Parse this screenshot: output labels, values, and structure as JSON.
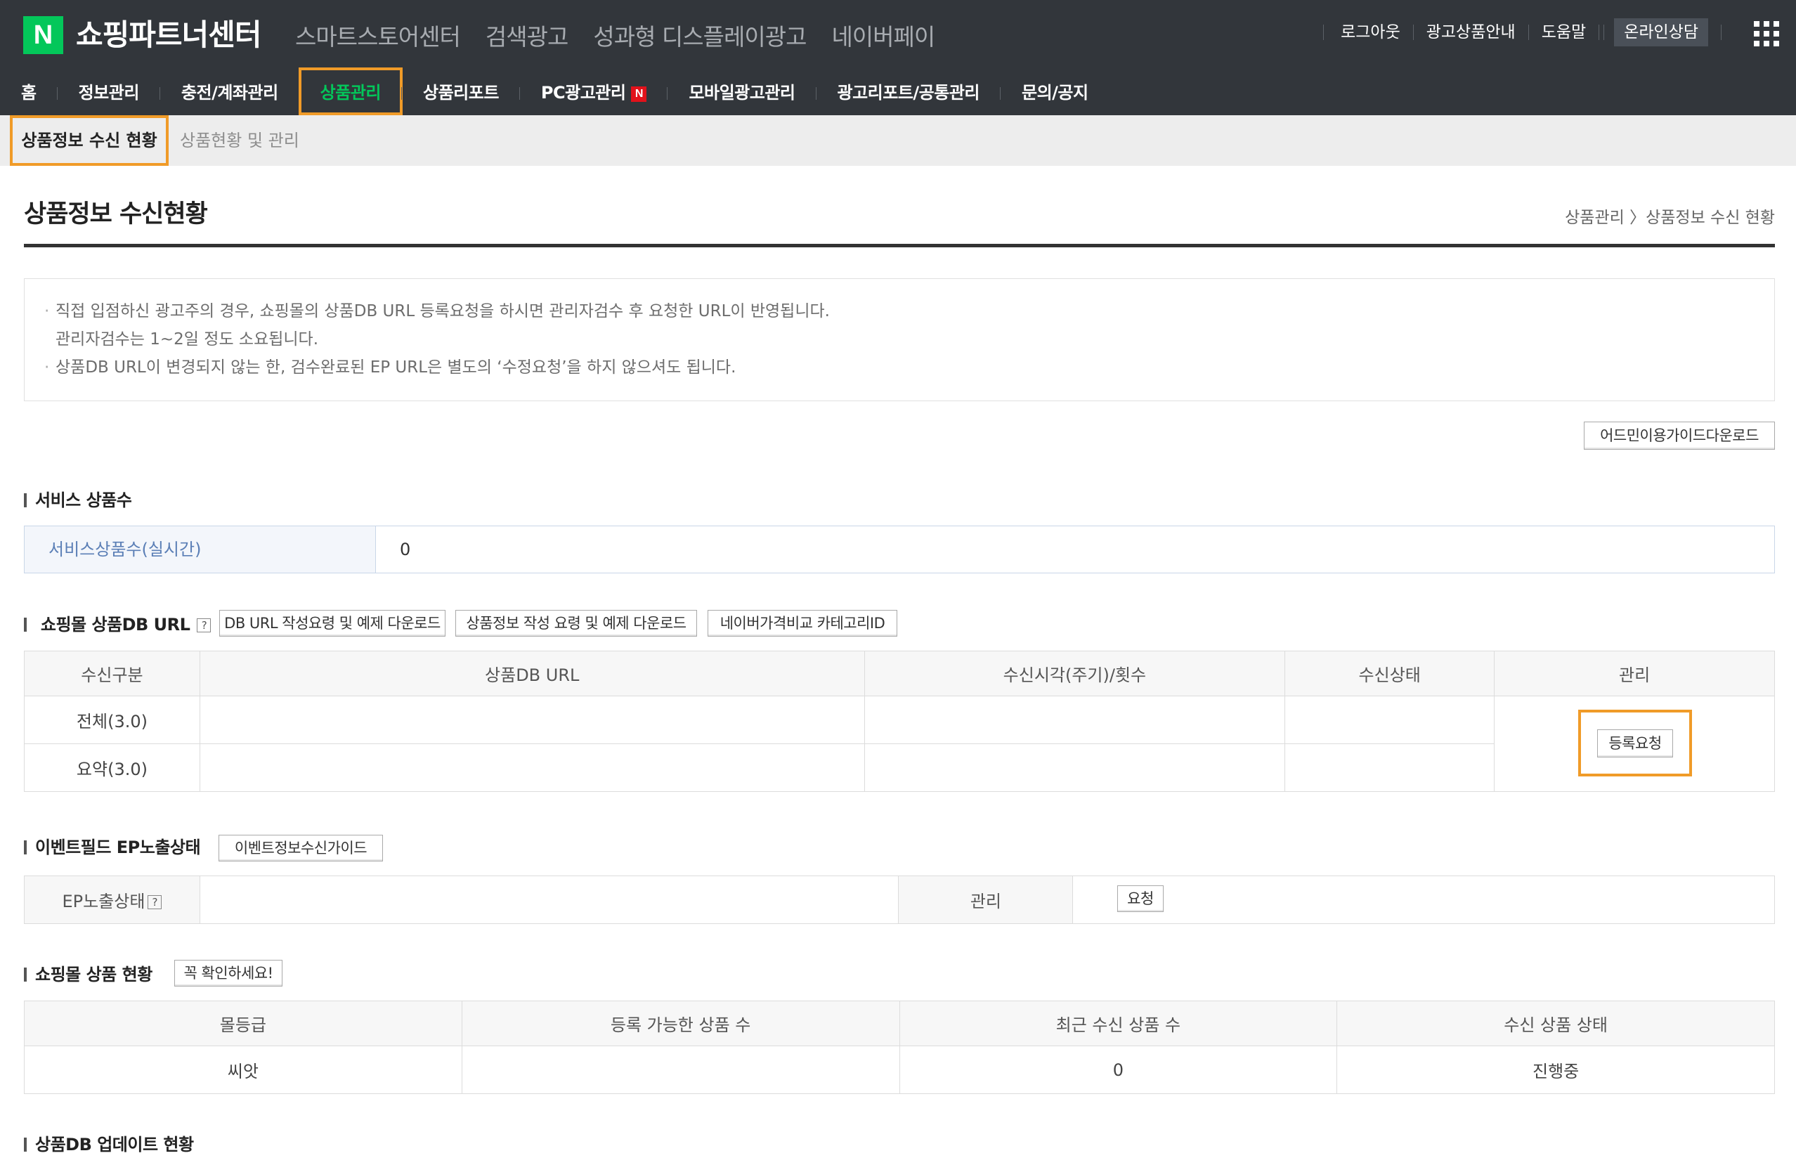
{
  "header": {
    "logo_letter": "N",
    "brand": "쇼핑파트너센터",
    "services": [
      "스마트스토어센터",
      "검색광고",
      "성과형 디스플레이광고",
      "네이버페이"
    ],
    "util_links": [
      "로그아웃",
      "광고상품안내",
      "도움말"
    ],
    "consult_label": "온라인상담"
  },
  "gnb": {
    "items": [
      "홈",
      "정보관리",
      "충전/계좌관리",
      "상품관리",
      "상품리포트",
      "PC광고관리",
      "모바일광고관리",
      "광고리포트/공통관리",
      "문의/공지"
    ],
    "badge": "N"
  },
  "lnb": {
    "active": "상품정보 수신 현황",
    "other": "상품현황 및 관리"
  },
  "page": {
    "title": "상품정보 수신현황",
    "breadcrumb": "상품관리 〉상품정보 수신 현황"
  },
  "notice": {
    "line1": "직접 입점하신 광고주의 경우, 쇼핑몰의 상품DB URL 등록요청을 하시면 관리자검수 후 요청한 URL이 반영됩니다.",
    "line2": "관리자검수는 1~2일 정도 소요됩니다.",
    "line3": "상품DB URL이 변경되지 않는 한, 검수완료된 EP URL은 별도의 ‘수정요청’을 하지 않으셔도 됩니다."
  },
  "guide_download": "어드민이용가이드다운로드",
  "service_count": {
    "title": "서비스 상품수",
    "label": "서비스상품수(실시간)",
    "value": "0"
  },
  "db_url": {
    "title": "쇼핑몰 상품DB URL",
    "qmark": "?",
    "btn1": "DB URL 작성요령 및 예제 다운로드",
    "btn2": "상품정보 작성 요령 및 예제 다운로드",
    "btn3": "네이버가격비교 카테고리ID",
    "headers": [
      "수신구분",
      "상품DB URL",
      "수신시각(주기)/횟수",
      "수신상태",
      "관리"
    ],
    "rows": [
      {
        "type": "전체(3.0)",
        "url": "",
        "time": "",
        "status": ""
      },
      {
        "type": "요약(3.0)",
        "url": "",
        "time": "",
        "status": ""
      }
    ],
    "register_btn": "등록요청"
  },
  "event": {
    "title": "이벤트필드 EP노출상태",
    "guide_btn": "이벤트정보수신가이드",
    "label": "EP노출상태",
    "qmark": "?",
    "manage_label": "관리",
    "request_btn": "요청"
  },
  "mall_status": {
    "title": "쇼핑몰 상품 현황",
    "check_btn": "꼭 확인하세요!",
    "headers": [
      "몰등급",
      "등록 가능한 상품 수",
      "최근 수신 상품 수",
      "수신 상품 상태"
    ],
    "row": {
      "grade": "씨앗",
      "registrable": "",
      "recent": "0",
      "state": "진행중"
    }
  },
  "db_update": {
    "title": "상품DB 업데이트 현황"
  }
}
